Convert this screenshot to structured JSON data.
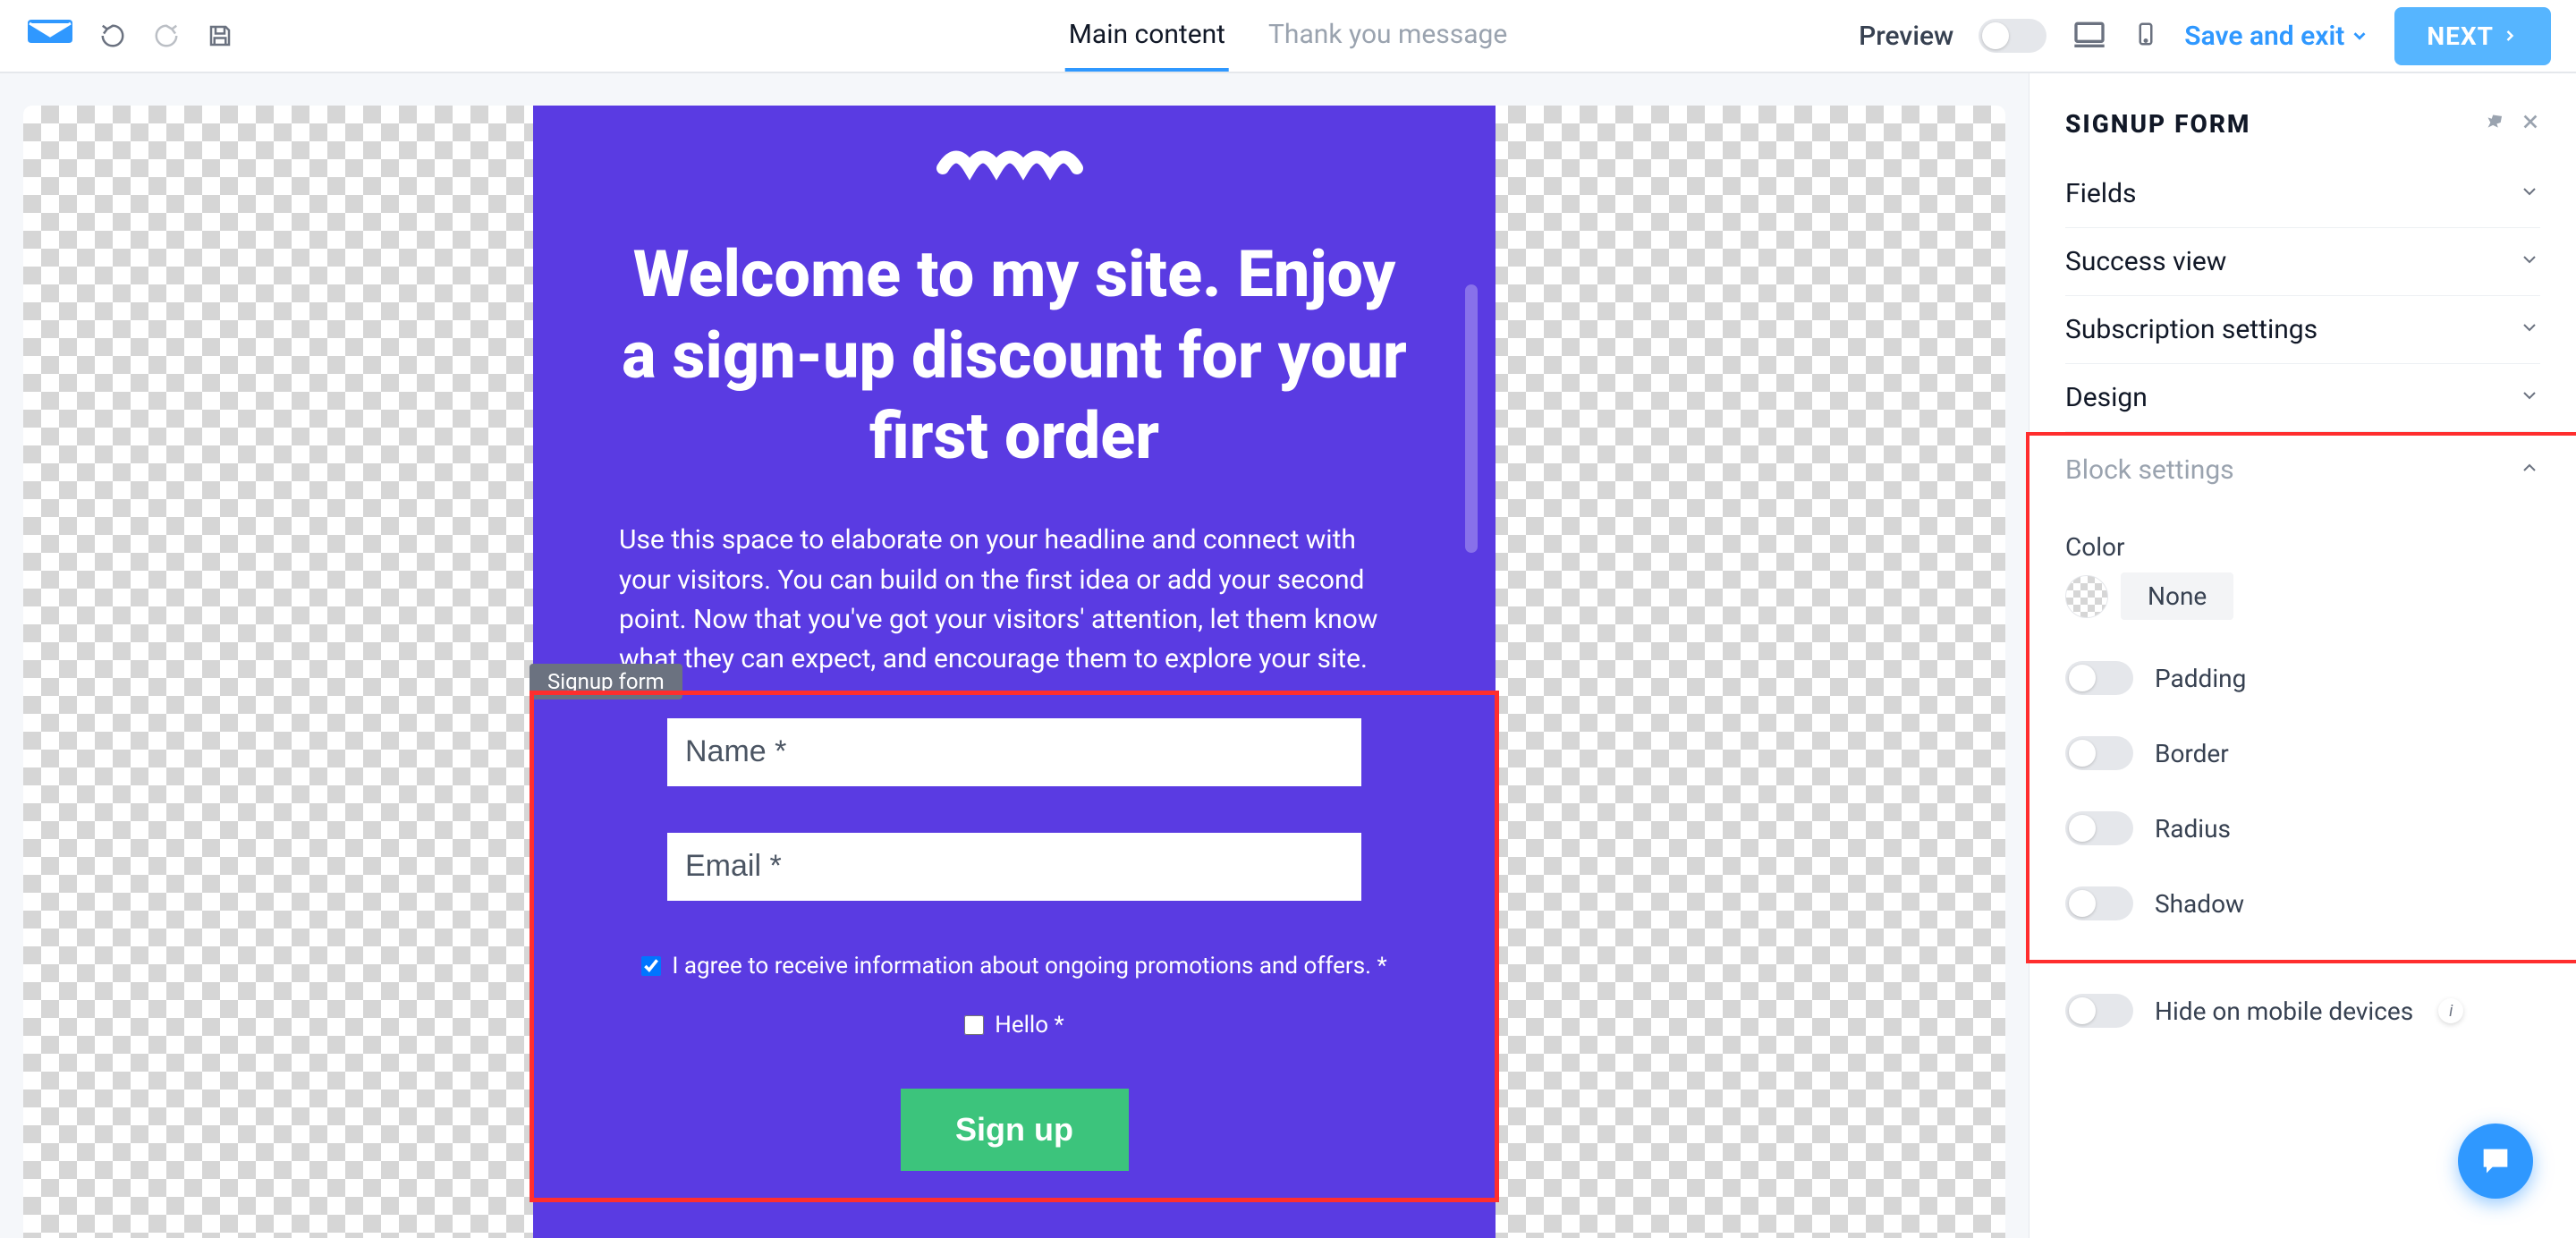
{
  "topbar": {
    "tabs": {
      "main": "Main content",
      "thank": "Thank you message"
    },
    "preview_label": "Preview",
    "save_exit": "Save and exit",
    "next": "NEXT"
  },
  "canvas": {
    "heading": "Welcome to my site. Enjoy a sign-up discount for your first order",
    "paragraph": "Use this space to elaborate on your headline and connect with your visitors. You can build on the first idea or add your second point. Now that you've got your visitors' attention, let them know what they can expect, and encourage them to explore your site.",
    "block_label": "Signup form",
    "name_placeholder": "Name *",
    "email_placeholder": "Email *",
    "agree_text": "I agree to receive information about ongoing promotions and offers. *",
    "hello_text": "Hello *",
    "signup_btn": "Sign up"
  },
  "panel": {
    "title": "SIGNUP FORM",
    "acc": {
      "fields": "Fields",
      "success": "Success view",
      "subscription": "Subscription settings",
      "design": "Design",
      "block": "Block settings"
    },
    "settings": {
      "color_label": "Color",
      "color_value": "None",
      "padding": "Padding",
      "border": "Border",
      "radius": "Radius",
      "shadow": "Shadow",
      "hide_mobile": "Hide on mobile devices"
    }
  }
}
